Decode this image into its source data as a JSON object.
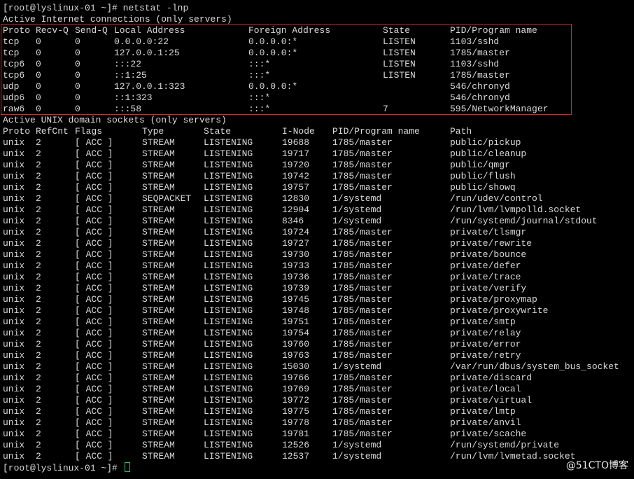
{
  "terminal": {
    "prompt": "[root@lyslinux-01 ~]# ",
    "command": "netstat -lnp",
    "final_prompt": "[root@lyslinux-01 ~]# ",
    "watermark": "@51CTO博客",
    "colors": {
      "background": "#000000",
      "text": "#d9d9d9",
      "highlight_border": "#d62828",
      "cursor": "#22c55e"
    }
  },
  "inet": {
    "section_title": "Active Internet connections (only servers)",
    "headers": [
      "Proto",
      "Recv-Q",
      "Send-Q",
      "Local Address",
      "Foreign Address",
      "State",
      "PID/Program name"
    ],
    "rows": [
      [
        "tcp",
        "0",
        "0",
        "0.0.0.0:22",
        "0.0.0.0:*",
        "LISTEN",
        "1103/sshd"
      ],
      [
        "tcp",
        "0",
        "0",
        "127.0.0.1:25",
        "0.0.0.0:*",
        "LISTEN",
        "1785/master"
      ],
      [
        "tcp6",
        "0",
        "0",
        ":::22",
        ":::*",
        "LISTEN",
        "1103/sshd"
      ],
      [
        "tcp6",
        "0",
        "0",
        "::1:25",
        ":::*",
        "LISTEN",
        "1785/master"
      ],
      [
        "udp",
        "0",
        "0",
        "127.0.0.1:323",
        "0.0.0.0:*",
        "",
        "546/chronyd"
      ],
      [
        "udp6",
        "0",
        "0",
        "::1:323",
        ":::*",
        "",
        "546/chronyd"
      ],
      [
        "raw6",
        "0",
        "0",
        ":::58",
        ":::*",
        "7",
        "595/NetworkManager"
      ]
    ]
  },
  "unix": {
    "section_title": "Active UNIX domain sockets (only servers)",
    "headers": [
      "Proto",
      "RefCnt",
      "Flags",
      "Type",
      "State",
      "I-Node",
      "PID/Program name",
      "Path"
    ],
    "rows": [
      [
        "unix",
        "2",
        "[ ACC ]",
        "STREAM",
        "LISTENING",
        "19688",
        "1785/master",
        "public/pickup"
      ],
      [
        "unix",
        "2",
        "[ ACC ]",
        "STREAM",
        "LISTENING",
        "19717",
        "1785/master",
        "public/cleanup"
      ],
      [
        "unix",
        "2",
        "[ ACC ]",
        "STREAM",
        "LISTENING",
        "19720",
        "1785/master",
        "public/qmgr"
      ],
      [
        "unix",
        "2",
        "[ ACC ]",
        "STREAM",
        "LISTENING",
        "19742",
        "1785/master",
        "public/flush"
      ],
      [
        "unix",
        "2",
        "[ ACC ]",
        "STREAM",
        "LISTENING",
        "19757",
        "1785/master",
        "public/showq"
      ],
      [
        "unix",
        "2",
        "[ ACC ]",
        "SEQPACKET",
        "LISTENING",
        "12830",
        "1/systemd",
        "/run/udev/control"
      ],
      [
        "unix",
        "2",
        "[ ACC ]",
        "STREAM",
        "LISTENING",
        "12904",
        "1/systemd",
        "/run/lvm/lvmpolld.socket"
      ],
      [
        "unix",
        "2",
        "[ ACC ]",
        "STREAM",
        "LISTENING",
        "8346",
        "1/systemd",
        "/run/systemd/journal/stdout"
      ],
      [
        "unix",
        "2",
        "[ ACC ]",
        "STREAM",
        "LISTENING",
        "19724",
        "1785/master",
        "private/tlsmgr"
      ],
      [
        "unix",
        "2",
        "[ ACC ]",
        "STREAM",
        "LISTENING",
        "19727",
        "1785/master",
        "private/rewrite"
      ],
      [
        "unix",
        "2",
        "[ ACC ]",
        "STREAM",
        "LISTENING",
        "19730",
        "1785/master",
        "private/bounce"
      ],
      [
        "unix",
        "2",
        "[ ACC ]",
        "STREAM",
        "LISTENING",
        "19733",
        "1785/master",
        "private/defer"
      ],
      [
        "unix",
        "2",
        "[ ACC ]",
        "STREAM",
        "LISTENING",
        "19736",
        "1785/master",
        "private/trace"
      ],
      [
        "unix",
        "2",
        "[ ACC ]",
        "STREAM",
        "LISTENING",
        "19739",
        "1785/master",
        "private/verify"
      ],
      [
        "unix",
        "2",
        "[ ACC ]",
        "STREAM",
        "LISTENING",
        "19745",
        "1785/master",
        "private/proxymap"
      ],
      [
        "unix",
        "2",
        "[ ACC ]",
        "STREAM",
        "LISTENING",
        "19748",
        "1785/master",
        "private/proxywrite"
      ],
      [
        "unix",
        "2",
        "[ ACC ]",
        "STREAM",
        "LISTENING",
        "19751",
        "1785/master",
        "private/smtp"
      ],
      [
        "unix",
        "2",
        "[ ACC ]",
        "STREAM",
        "LISTENING",
        "19754",
        "1785/master",
        "private/relay"
      ],
      [
        "unix",
        "2",
        "[ ACC ]",
        "STREAM",
        "LISTENING",
        "19760",
        "1785/master",
        "private/error"
      ],
      [
        "unix",
        "2",
        "[ ACC ]",
        "STREAM",
        "LISTENING",
        "19763",
        "1785/master",
        "private/retry"
      ],
      [
        "unix",
        "2",
        "[ ACC ]",
        "STREAM",
        "LISTENING",
        "15030",
        "1/systemd",
        "/var/run/dbus/system_bus_socket"
      ],
      [
        "unix",
        "2",
        "[ ACC ]",
        "STREAM",
        "LISTENING",
        "19766",
        "1785/master",
        "private/discard"
      ],
      [
        "unix",
        "2",
        "[ ACC ]",
        "STREAM",
        "LISTENING",
        "19769",
        "1785/master",
        "private/local"
      ],
      [
        "unix",
        "2",
        "[ ACC ]",
        "STREAM",
        "LISTENING",
        "19772",
        "1785/master",
        "private/virtual"
      ],
      [
        "unix",
        "2",
        "[ ACC ]",
        "STREAM",
        "LISTENING",
        "19775",
        "1785/master",
        "private/lmtp"
      ],
      [
        "unix",
        "2",
        "[ ACC ]",
        "STREAM",
        "LISTENING",
        "19778",
        "1785/master",
        "private/anvil"
      ],
      [
        "unix",
        "2",
        "[ ACC ]",
        "STREAM",
        "LISTENING",
        "19781",
        "1785/master",
        "private/scache"
      ],
      [
        "unix",
        "2",
        "[ ACC ]",
        "STREAM",
        "LISTENING",
        "12526",
        "1/systemd",
        "/run/systemd/private"
      ],
      [
        "unix",
        "2",
        "[ ACC ]",
        "STREAM",
        "LISTENING",
        "12537",
        "1/systemd",
        "/run/lvm/lvmetad.socket"
      ]
    ]
  }
}
